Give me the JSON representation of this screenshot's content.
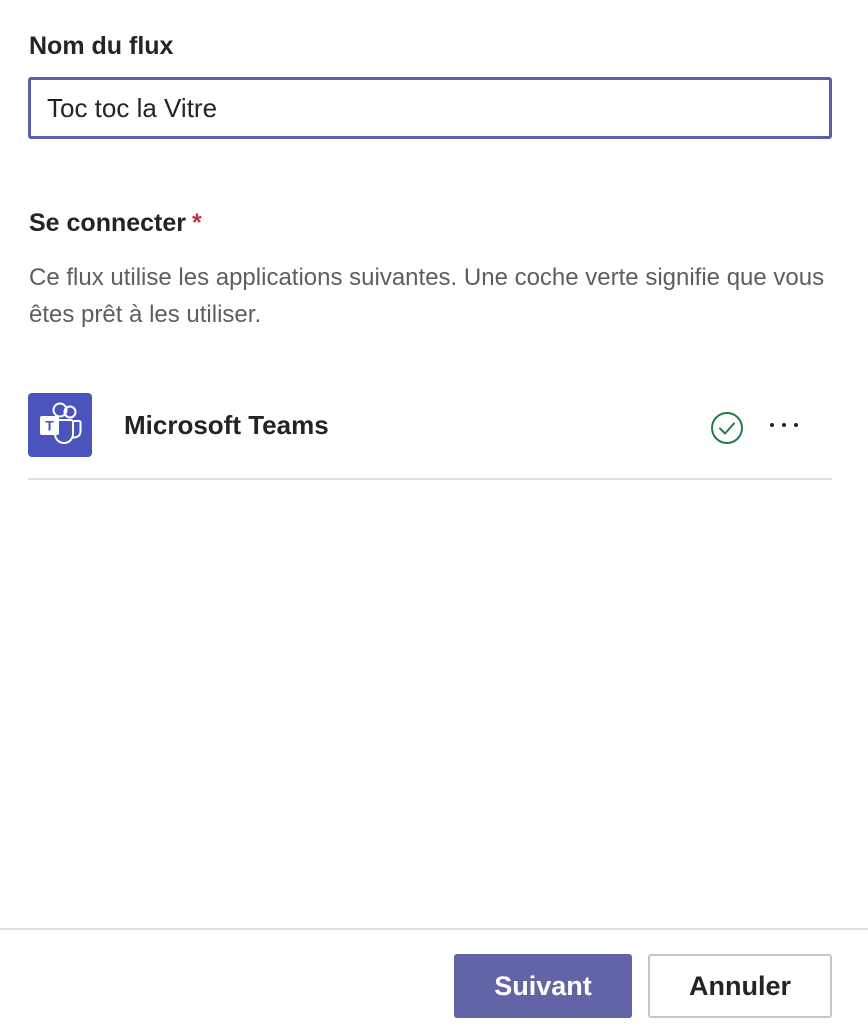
{
  "flow_name": {
    "label": "Nom du flux",
    "value": "Toc toc la Vitre"
  },
  "connect": {
    "label": "Se connecter",
    "required_marker": "*",
    "description": "Ce flux utilise les applications suivantes. Une coche verte signifie que vous êtes prêt à les utiliser."
  },
  "apps": [
    {
      "name": "Microsoft Teams",
      "icon": "microsoft-teams-icon",
      "status": "connected",
      "status_icon": "green-check-icon",
      "menu_icon": "more-options-icon"
    }
  ],
  "footer": {
    "next_label": "Suivant",
    "cancel_label": "Annuler"
  },
  "colors": {
    "accent": "#6264a7",
    "input_border": "#5b5fa7",
    "teams_brand": "#4b53bc",
    "success": "#237b4b",
    "required": "#c4314b"
  }
}
